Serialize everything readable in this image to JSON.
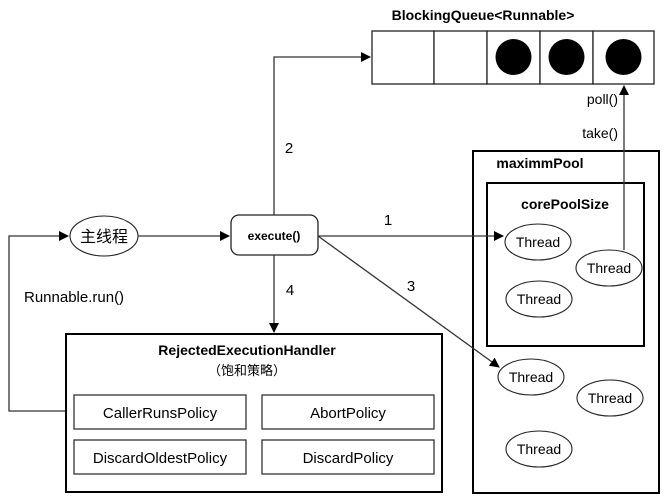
{
  "queue": {
    "title": "BlockingQueue<Runnable>",
    "slots": [
      false,
      false,
      true,
      true,
      true
    ]
  },
  "poll_label": "poll()",
  "take_label": "take()",
  "main_thread": "主线程",
  "execute": "execute()",
  "runnable_run": "Runnable.run()",
  "arrow_labels": {
    "one": "1",
    "two": "2",
    "three": "3",
    "four": "4"
  },
  "max_pool": {
    "title": "maximmPool",
    "threads": [
      "Thread",
      "Thread",
      "Thread"
    ]
  },
  "core_pool": {
    "title": "corePoolSize",
    "threads": [
      "Thread",
      "Thread",
      "Thread"
    ]
  },
  "handler": {
    "title": "RejectedExecutionHandler",
    "subtitle": "（饱和策略）",
    "policies": [
      "CallerRunsPolicy",
      "AbortPolicy",
      "DiscardOldestPolicy",
      "DiscardPolicy"
    ]
  }
}
